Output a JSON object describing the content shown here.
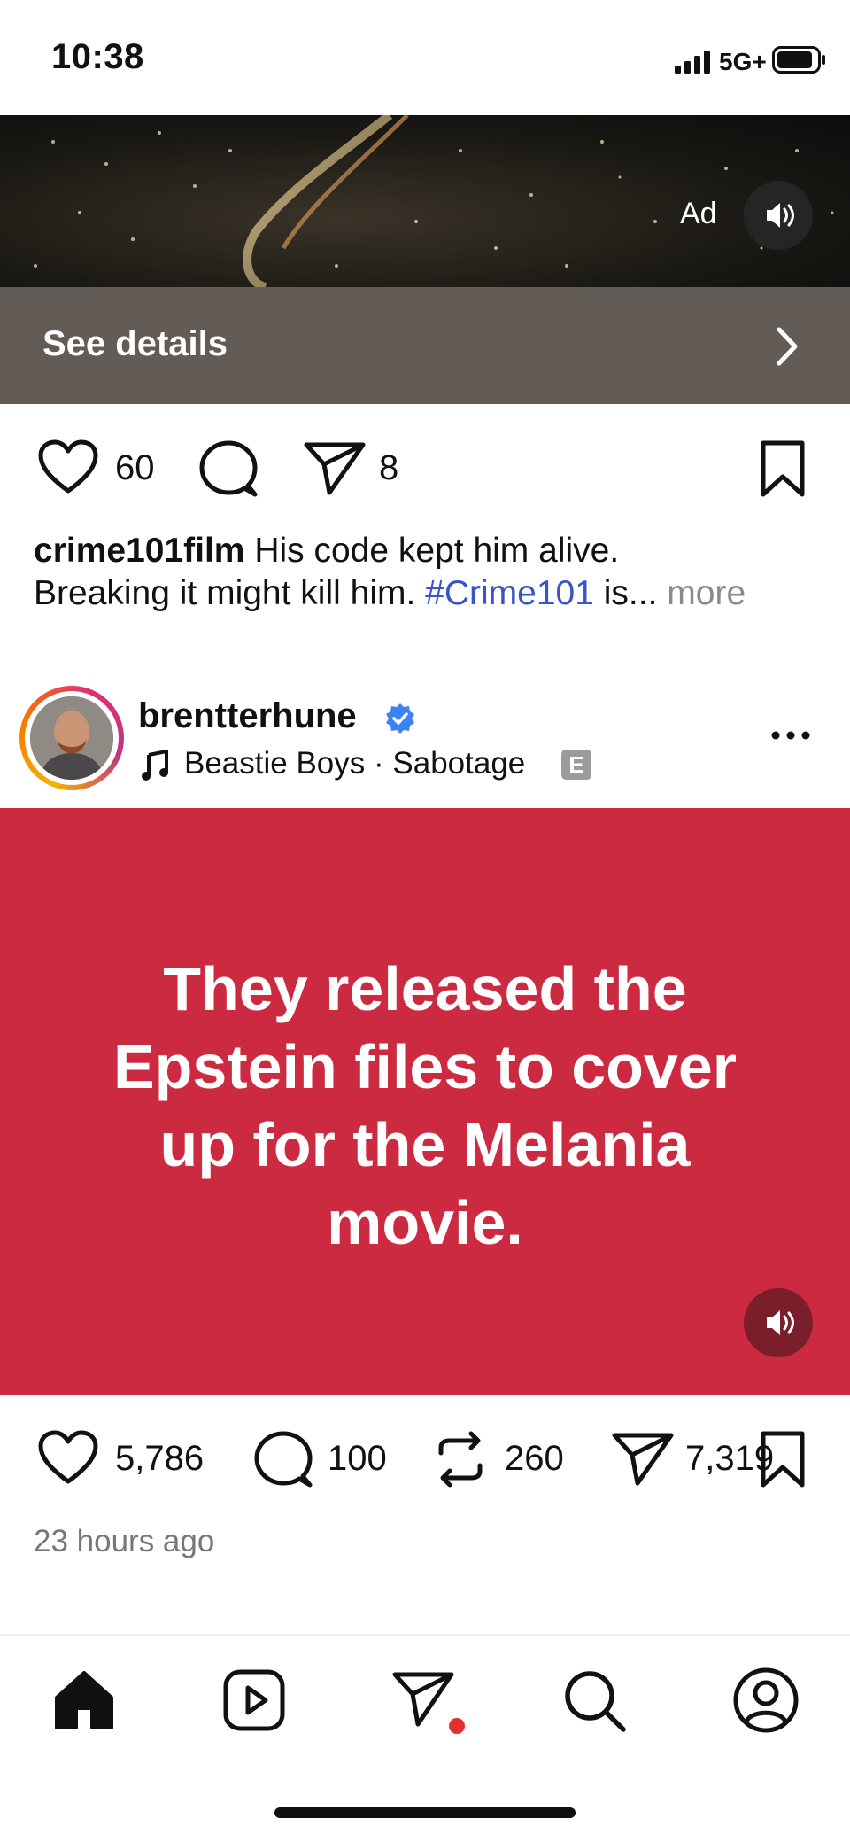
{
  "status_bar": {
    "time": "10:38",
    "network": "5G+"
  },
  "ad_post": {
    "ad_label": "Ad",
    "see_details_label": "See details",
    "likes": "60",
    "shares": "8",
    "caption": {
      "username": "crime101film",
      "text_line1": "His code kept him alive.",
      "text_line2": "Breaking it might kill him.",
      "hashtag": "#Crime101",
      "tail": "is...",
      "more": "more"
    }
  },
  "post": {
    "username": "brentterhune",
    "song_artist": "Beastie Boys",
    "song_separator": "·",
    "song_title": "Sabotage",
    "explicit_badge": "E",
    "quote": "They released the Epstein files to cover up for the Melania movie.",
    "card_color": "#cc2a40",
    "likes": "5,786",
    "comments": "100",
    "reposts": "260",
    "shares": "7,319",
    "timestamp": "23 hours ago"
  },
  "nav": {
    "items": [
      "home-icon",
      "reels-icon",
      "direct-icon",
      "search-icon",
      "profile-icon"
    ],
    "notification_dot_color": "#e0302f"
  },
  "colors": {
    "hashtag": "#3a53c9",
    "verified": "#3b82f6",
    "see_details_bg": "#635c56"
  }
}
